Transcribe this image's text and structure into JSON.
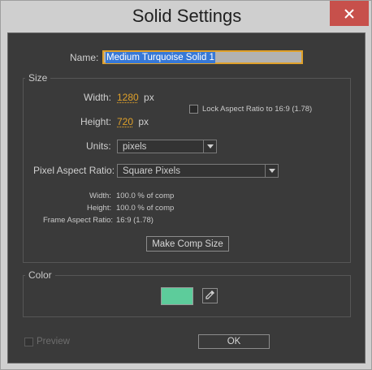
{
  "window": {
    "title": "Solid Settings"
  },
  "name_field": {
    "label": "Name:",
    "value": "Medium Turquoise Solid 1"
  },
  "size": {
    "group_label": "Size",
    "width_label": "Width:",
    "width_value": "1280",
    "width_unit": "px",
    "height_label": "Height:",
    "height_value": "720",
    "height_unit": "px",
    "lock_label": "Lock Aspect Ratio to 16:9 (1.78)",
    "lock_checked": false,
    "units_label": "Units:",
    "units_value": "pixels",
    "par_label": "Pixel Aspect Ratio:",
    "par_value": "Square Pixels",
    "info_width_label": "Width:",
    "info_width_value": "100.0 % of comp",
    "info_height_label": "Height:",
    "info_height_value": "100.0 % of comp",
    "info_far_label": "Frame Aspect Ratio:",
    "info_far_value": "16:9 (1.78)",
    "make_comp_size_label": "Make Comp Size"
  },
  "color": {
    "group_label": "Color",
    "swatch_color": "#5dcc9b"
  },
  "footer": {
    "preview_label": "Preview",
    "preview_checked": false,
    "ok_label": "OK"
  },
  "icons": {
    "close": "close-icon",
    "dropdown_arrow": "chevron-down-icon",
    "eyedropper": "eyedropper-icon"
  }
}
